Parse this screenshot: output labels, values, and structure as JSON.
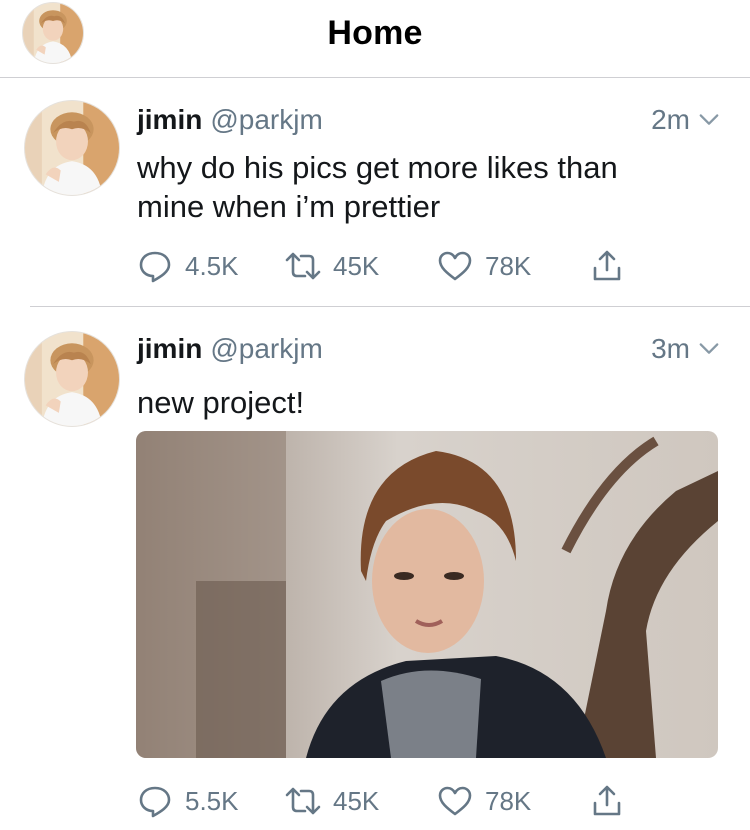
{
  "header": {
    "title": "Home"
  },
  "tweets": [
    {
      "name": "jimin",
      "handle": "@parkjm",
      "time": "2m",
      "text_line1": "why do his pics get more likes than",
      "text_line2": "mine when i’m prettier",
      "replies": "4.5K",
      "retweets": "45K",
      "likes": "78K"
    },
    {
      "name": "jimin",
      "handle": "@parkjm",
      "time": "3m",
      "text_line1": "new project!",
      "replies": "5.5K",
      "retweets": "45K",
      "likes": "78K"
    }
  ],
  "icons": [
    "chevron-down-icon",
    "reply-icon",
    "retweet-icon",
    "like-icon",
    "share-icon"
  ],
  "colors": {
    "text": "#14171a",
    "muted": "#657786",
    "divider": "#cfcfd3"
  }
}
